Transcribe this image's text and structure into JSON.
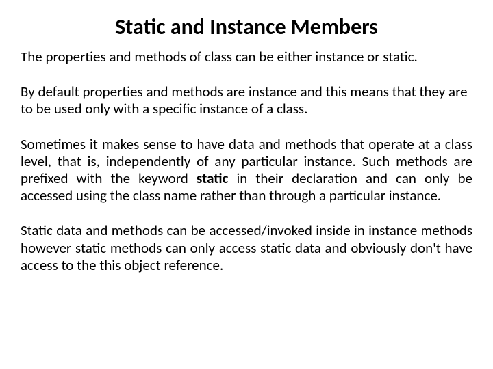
{
  "title": "Static and Instance Members",
  "p1": "The properties and methods of class can be either instance or static.",
  "p2": "By default properties and methods are instance and this means that they are to be used only with a specific instance of a class.",
  "p3_a": "Sometimes it makes sense to have data and methods that operate at a class level, that is, independently of any particular instance. Such methods are prefixed with the keyword ",
  "p3_bold": "static",
  "p3_b": " in their declaration and can only be accessed using the class name rather than through a particular instance.",
  "p4": "Static data and methods can be accessed/invoked inside in instance methods however static methods can only access static data and obviously don't have access to the this object reference."
}
